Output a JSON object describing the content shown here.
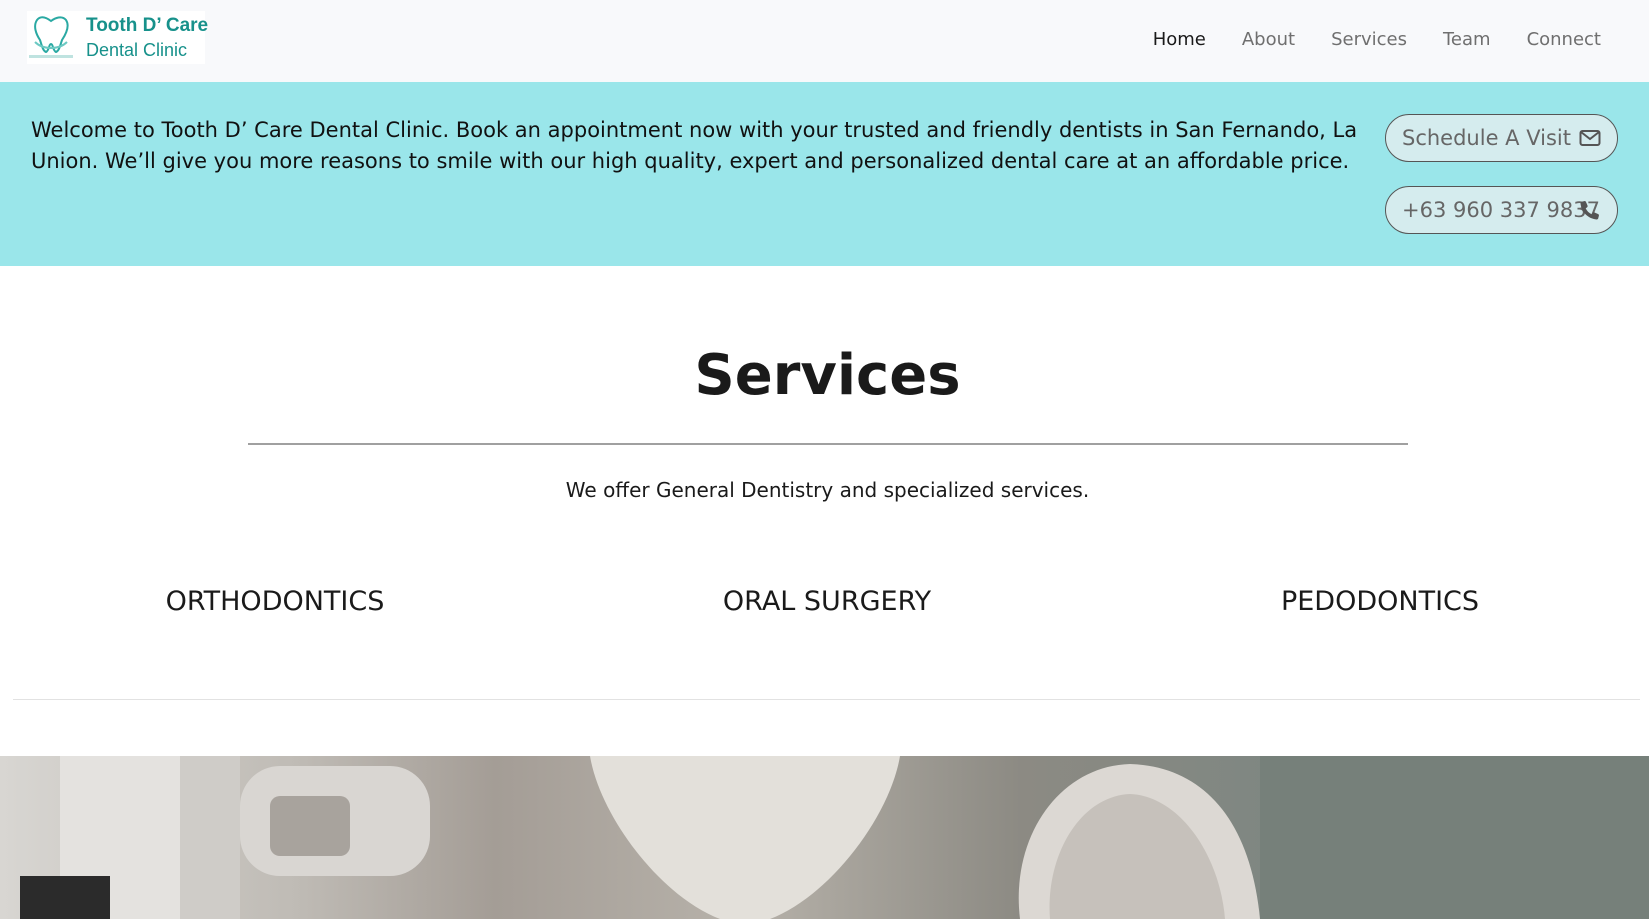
{
  "header": {
    "logo_title": "Tooth D’ Care",
    "logo_subtitle": "Dental Clinic",
    "logo_icon": "tooth-logo-icon",
    "nav": [
      {
        "label": "Home",
        "active": true
      },
      {
        "label": "About",
        "active": false
      },
      {
        "label": "Services",
        "active": false
      },
      {
        "label": "Team",
        "active": false
      },
      {
        "label": "Connect",
        "active": false
      }
    ]
  },
  "banner": {
    "text": "Welcome to Tooth D’ Care Dental Clinic. Book an appointment now with your trusted and friendly dentists in San Fernando, La Union. We’ll give you more reasons to smile with our high quality, expert and personalized dental care at an affordable price.",
    "schedule_label": "Schedule A Visit",
    "schedule_icon": "envelope-icon",
    "phone_label": "+63 960 337 9837",
    "phone_icon": "phone-icon",
    "background": "#9ae6ea"
  },
  "services": {
    "title": "Services",
    "subtitle": "We offer General Dentistry and specialized services.",
    "categories": [
      "ORTHODONTICS",
      "ORAL SURGERY",
      "PEDODONTICS"
    ]
  },
  "colors": {
    "brand": "#17918b",
    "header_bg": "#f8f9fb"
  }
}
